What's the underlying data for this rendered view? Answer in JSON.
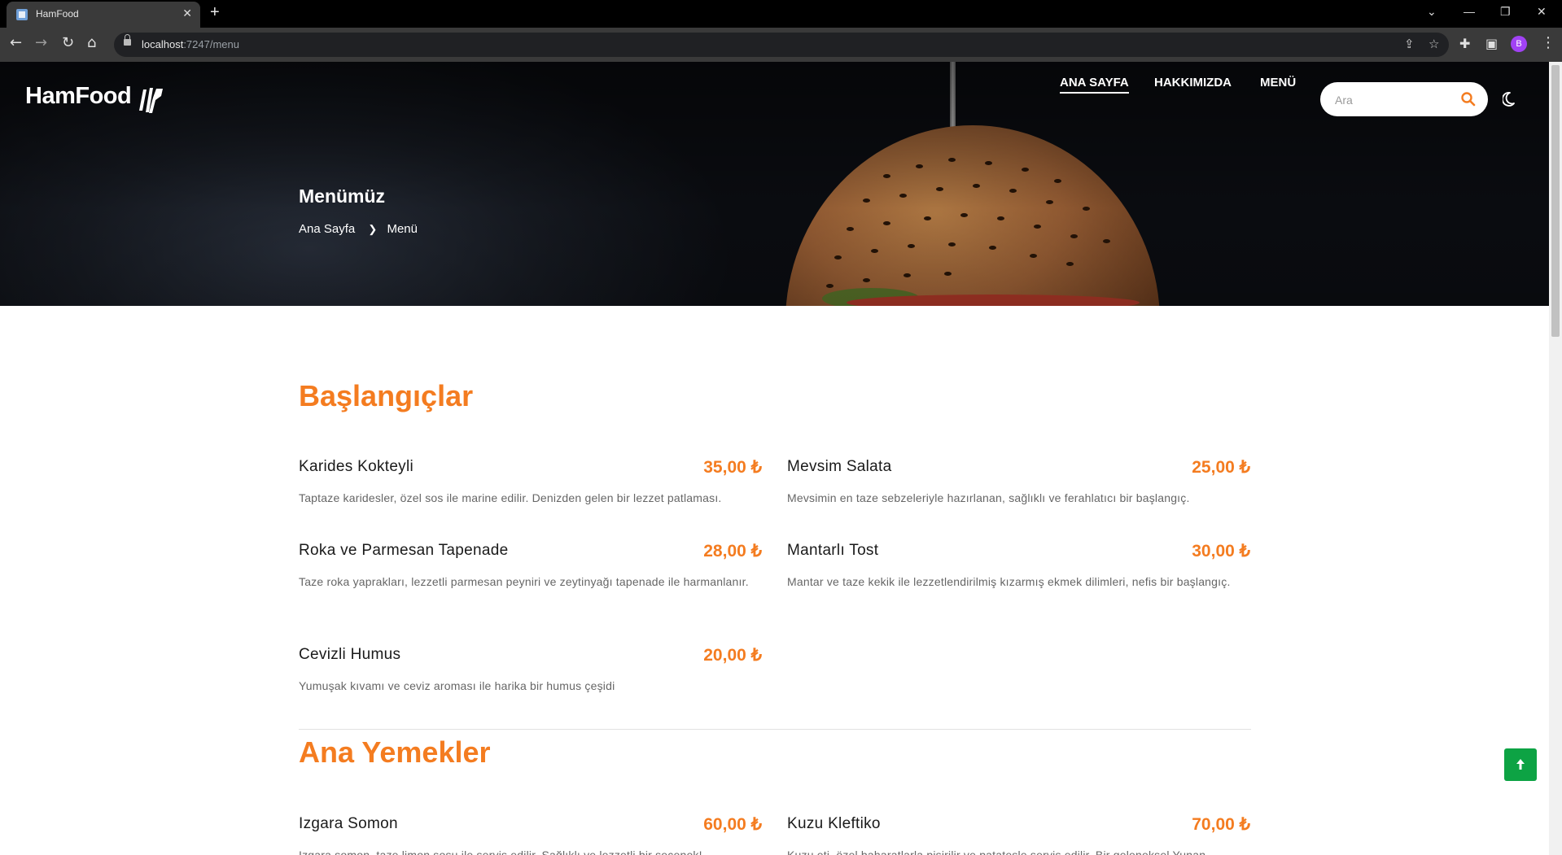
{
  "browser": {
    "tab_title": "HamFood",
    "url_host": "localhost",
    "url_path": ":7247/menu",
    "profile_initial": "B"
  },
  "site": {
    "logo_text": "HamFood",
    "nav": [
      "ANA SAYFA",
      "HAKKIMIZDA",
      "MENÜ"
    ],
    "search_placeholder": "Ara",
    "accent_color": "#f47c20",
    "back_to_top_color": "#0da344"
  },
  "hero": {
    "title": "Menümüz",
    "breadcrumb": [
      "Ana Sayfa",
      "Menü"
    ]
  },
  "sections": [
    {
      "title": "Başlangıçlar",
      "items": [
        {
          "name": "Karides Kokteyli",
          "price": "35,00 ₺",
          "desc": "Taptaze karidesler, özel sos ile marine edilir. Denizden gelen bir lezzet patlaması."
        },
        {
          "name": "Mevsim Salata",
          "price": "25,00 ₺",
          "desc": "Mevsimin en taze sebzeleriyle hazırlanan, sağlıklı ve ferahlatıcı bir başlangıç."
        },
        {
          "name": "Roka ve Parmesan Tapenade",
          "price": "28,00 ₺",
          "desc": "Taze roka yaprakları, lezzetli parmesan peyniri ve zeytinyağı tapenade ile harmanlanır."
        },
        {
          "name": "Mantarlı Tost",
          "price": "30,00 ₺",
          "desc": "Mantar ve taze kekik ile lezzetlendirilmiş kızarmış ekmek dilimleri, nefis bir başlangıç."
        },
        {
          "name": "Cevizli Humus",
          "price": "20,00 ₺",
          "desc": "Yumuşak kıvamı ve ceviz aroması ile harika bir humus çeşidi"
        }
      ]
    },
    {
      "title": "Ana Yemekler",
      "items": [
        {
          "name": "Izgara Somon",
          "price": "60,00 ₺",
          "desc": "Izgara somon, taze limon sosu ile servis edilir. Sağlıklı ve lezzetli bir seçenek!"
        },
        {
          "name": "Kuzu Kleftiko",
          "price": "70,00 ₺",
          "desc": "Kuzu eti, özel baharatlarla pişirilir ve patatesle servis edilir. Bir geleneksel Yunan"
        }
      ]
    }
  ]
}
